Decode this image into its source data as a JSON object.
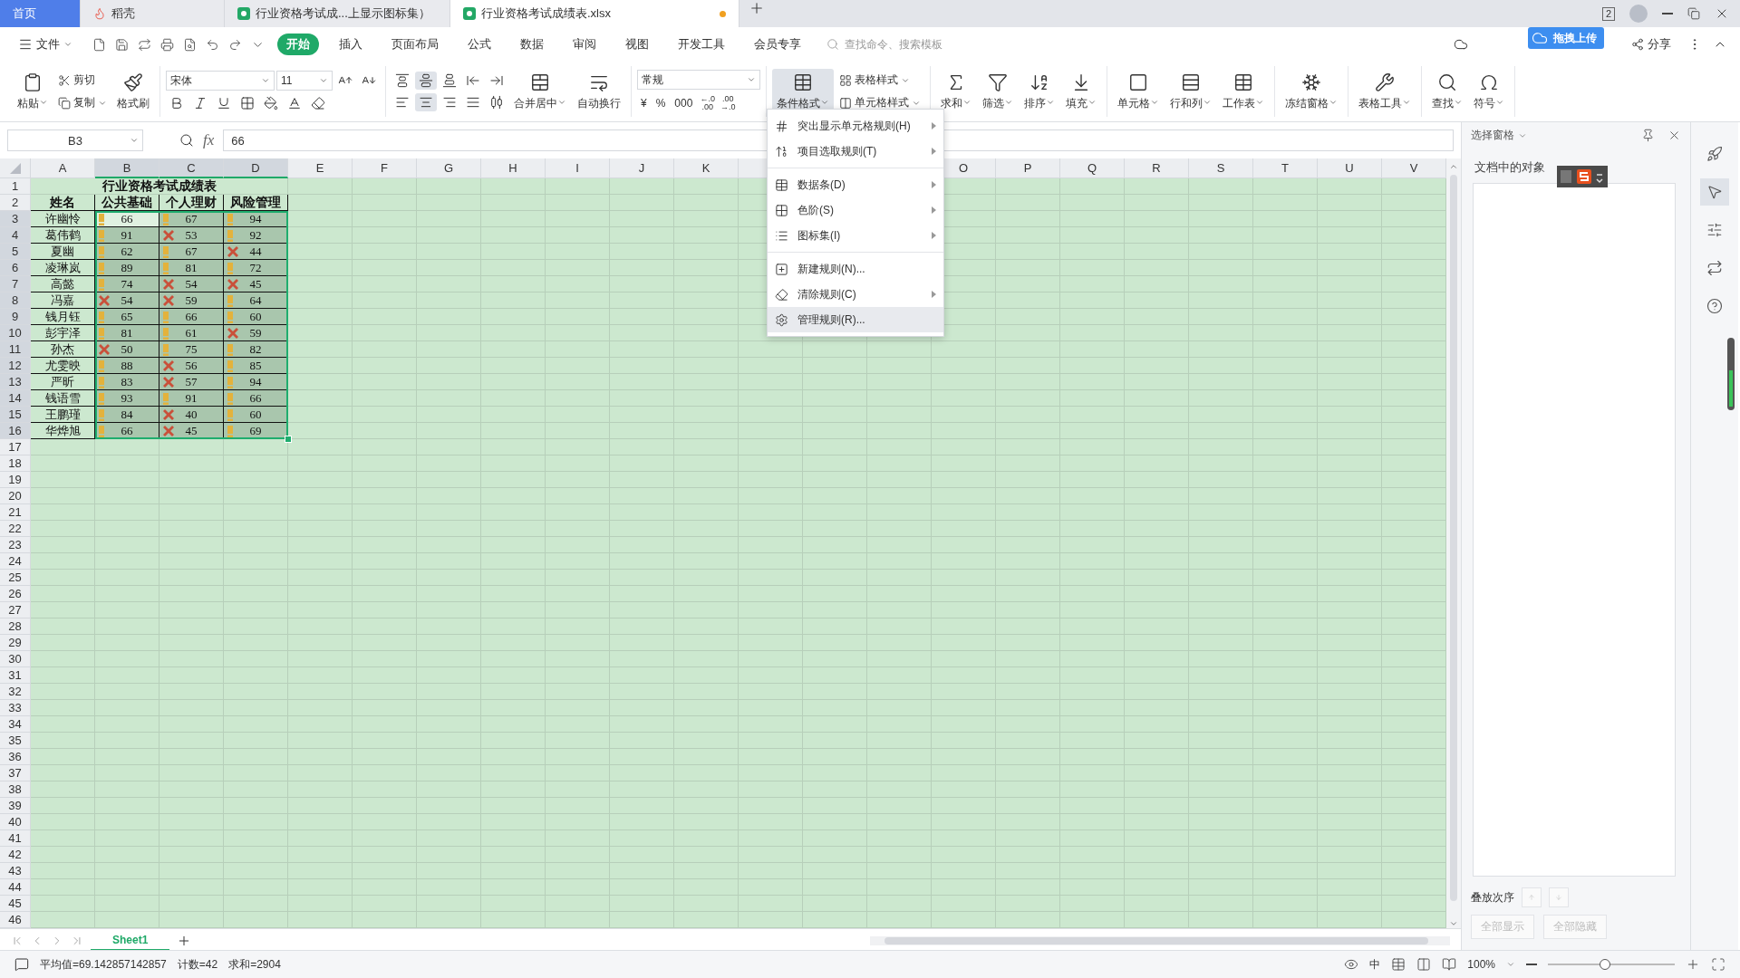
{
  "tabs": [
    {
      "kind": "home",
      "label": "首页",
      "selected": false,
      "unsaved": false
    },
    {
      "kind": "docer",
      "label": "稻壳",
      "selected": false,
      "unsaved": false
    },
    {
      "kind": "sheet",
      "label": "行业资格考试成...上显示图标集）",
      "selected": false,
      "unsaved": false
    },
    {
      "kind": "sheet",
      "label": "行业资格考试成绩表.xlsx",
      "selected": true,
      "unsaved": true
    }
  ],
  "window_count": "2",
  "menubar": {
    "file": "文件",
    "items": [
      {
        "label": "开始",
        "selected": true
      },
      {
        "label": "插入",
        "selected": false
      },
      {
        "label": "页面布局",
        "selected": false
      },
      {
        "label": "公式",
        "selected": false
      },
      {
        "label": "数据",
        "selected": false
      },
      {
        "label": "审阅",
        "selected": false
      },
      {
        "label": "视图",
        "selected": false
      },
      {
        "label": "开发工具",
        "selected": false
      },
      {
        "label": "会员专享",
        "selected": false
      }
    ],
    "search": {
      "placeholder": "查找命令、搜索模板"
    },
    "upload_badge": "拖拽上传",
    "share": "分享"
  },
  "ribbon": {
    "paste": "粘贴",
    "cut": "剪切",
    "copy": "复制",
    "format_painter": "格式刷",
    "font": "宋体",
    "font_size": "11",
    "alignment": {
      "vertical": [
        {
          "pressed": false
        },
        {
          "pressed": true
        },
        {
          "pressed": false
        }
      ],
      "horizontal": [
        {
          "pressed": false
        },
        {
          "pressed": true
        },
        {
          "pressed": false
        },
        {
          "pressed": false
        }
      ]
    },
    "merge": "合并居中",
    "wrap": "自动换行",
    "number_format": "常规",
    "number_buttons": [
      "¥",
      "%",
      "000"
    ],
    "decimal_buttons": [
      {
        "top": "←.0",
        "bottom": ".00"
      },
      {
        "top": ".00",
        "bottom": "→.0"
      }
    ],
    "conditional_format": {
      "label": "条件格式",
      "pressed": true
    },
    "table_style": "表格样式",
    "cell_style": "单元格样式",
    "tools": [
      "求和",
      "筛选",
      "排序",
      "填充",
      "单元格",
      "行和列",
      "工作表",
      "冻结窗格",
      "表格工具",
      "查找",
      "符号"
    ]
  },
  "formula_bar": {
    "name_box": "B3",
    "fx": "fx",
    "value": "66"
  },
  "sheet": {
    "columns": [
      {
        "label": "A",
        "selected": false
      },
      {
        "label": "B",
        "selected": true
      },
      {
        "label": "C",
        "selected": true
      },
      {
        "label": "D",
        "selected": true
      },
      {
        "label": "E",
        "selected": false
      },
      {
        "label": "F",
        "selected": false
      },
      {
        "label": "G",
        "selected": false
      },
      {
        "label": "H",
        "selected": false
      },
      {
        "label": "I",
        "selected": false
      },
      {
        "label": "J",
        "selected": false
      },
      {
        "label": "K",
        "selected": false
      },
      {
        "label": "O",
        "selected": false
      },
      {
        "label": "P",
        "selected": false
      },
      {
        "label": "Q",
        "selected": false
      },
      {
        "label": "R",
        "selected": false
      },
      {
        "label": "S",
        "selected": false
      },
      {
        "label": "T",
        "selected": false
      },
      {
        "label": "U",
        "selected": false
      },
      {
        "label": "V",
        "selected": false
      }
    ],
    "row_numbers": [
      {
        "label": "1",
        "selected": false
      },
      {
        "label": "2",
        "selected": false
      },
      {
        "label": "3",
        "selected": true
      },
      {
        "label": "4",
        "selected": true
      },
      {
        "label": "5",
        "selected": true
      },
      {
        "label": "6",
        "selected": true
      },
      {
        "label": "7",
        "selected": true
      },
      {
        "label": "8",
        "selected": true
      },
      {
        "label": "9",
        "selected": true
      },
      {
        "label": "10",
        "selected": true
      },
      {
        "label": "11",
        "selected": true
      },
      {
        "label": "12",
        "selected": true
      },
      {
        "label": "13",
        "selected": true
      },
      {
        "label": "14",
        "selected": true
      },
      {
        "label": "15",
        "selected": true
      },
      {
        "label": "16",
        "selected": true
      },
      {
        "label": "17",
        "selected": false
      },
      {
        "label": "18",
        "selected": false
      },
      {
        "label": "19",
        "selected": false
      },
      {
        "label": "20",
        "selected": false
      },
      {
        "label": "21",
        "selected": false
      },
      {
        "label": "22",
        "selected": false
      },
      {
        "label": "23",
        "selected": false
      },
      {
        "label": "24",
        "selected": false
      },
      {
        "label": "25",
        "selected": false
      },
      {
        "label": "26",
        "selected": false
      },
      {
        "label": "27",
        "selected": false
      },
      {
        "label": "28",
        "selected": false
      },
      {
        "label": "29",
        "selected": false
      },
      {
        "label": "30",
        "selected": false
      },
      {
        "label": "31",
        "selected": false
      },
      {
        "label": "32",
        "selected": false
      },
      {
        "label": "33",
        "selected": false
      },
      {
        "label": "34",
        "selected": false
      },
      {
        "label": "35",
        "selected": false
      },
      {
        "label": "36",
        "selected": false
      },
      {
        "label": "37",
        "selected": false
      },
      {
        "label": "38",
        "selected": false
      },
      {
        "label": "39",
        "selected": false
      },
      {
        "label": "40",
        "selected": false
      },
      {
        "label": "41",
        "selected": false
      },
      {
        "label": "42",
        "selected": false
      },
      {
        "label": "43",
        "selected": false
      },
      {
        "label": "44",
        "selected": false
      },
      {
        "label": "45",
        "selected": false
      },
      {
        "label": "46",
        "selected": false
      }
    ],
    "title": "行业资格考试成绩表",
    "headers": [
      "姓名",
      "公共基础",
      "个人理财",
      "风险管理"
    ],
    "rows": [
      {
        "name": "许幽怜",
        "scores": [
          {
            "value": "66",
            "kind": "warning",
            "active": true
          },
          {
            "value": "67",
            "kind": "warning",
            "active": false
          },
          {
            "value": "94",
            "kind": "warning",
            "active": false
          }
        ]
      },
      {
        "name": "葛伟鹤",
        "scores": [
          {
            "value": "91",
            "kind": "warning",
            "active": false
          },
          {
            "value": "53",
            "kind": "cross",
            "active": false
          },
          {
            "value": "92",
            "kind": "warning",
            "active": false
          }
        ]
      },
      {
        "name": "夏幽",
        "scores": [
          {
            "value": "62",
            "kind": "warning",
            "active": false
          },
          {
            "value": "67",
            "kind": "warning",
            "active": false
          },
          {
            "value": "44",
            "kind": "cross",
            "active": false
          }
        ]
      },
      {
        "name": "凌琳岚",
        "scores": [
          {
            "value": "89",
            "kind": "warning",
            "active": false
          },
          {
            "value": "81",
            "kind": "warning",
            "active": false
          },
          {
            "value": "72",
            "kind": "warning",
            "active": false
          }
        ]
      },
      {
        "name": "高懿",
        "scores": [
          {
            "value": "74",
            "kind": "warning",
            "active": false
          },
          {
            "value": "54",
            "kind": "cross",
            "active": false
          },
          {
            "value": "45",
            "kind": "cross",
            "active": false
          }
        ]
      },
      {
        "name": "冯嘉",
        "scores": [
          {
            "value": "54",
            "kind": "cross",
            "active": false
          },
          {
            "value": "59",
            "kind": "cross",
            "active": false
          },
          {
            "value": "64",
            "kind": "warning",
            "active": false
          }
        ]
      },
      {
        "name": "钱月钰",
        "scores": [
          {
            "value": "65",
            "kind": "warning",
            "active": false
          },
          {
            "value": "66",
            "kind": "warning",
            "active": false
          },
          {
            "value": "60",
            "kind": "warning",
            "active": false
          }
        ]
      },
      {
        "name": "彭宇泽",
        "scores": [
          {
            "value": "81",
            "kind": "warning",
            "active": false
          },
          {
            "value": "61",
            "kind": "warning",
            "active": false
          },
          {
            "value": "59",
            "kind": "cross",
            "active": false
          }
        ]
      },
      {
        "name": "孙杰",
        "scores": [
          {
            "value": "50",
            "kind": "cross",
            "active": false
          },
          {
            "value": "75",
            "kind": "warning",
            "active": false
          },
          {
            "value": "82",
            "kind": "warning",
            "active": false
          }
        ]
      },
      {
        "name": "尤雯映",
        "scores": [
          {
            "value": "88",
            "kind": "warning",
            "active": false
          },
          {
            "value": "56",
            "kind": "cross",
            "active": false
          },
          {
            "value": "85",
            "kind": "warning",
            "active": false
          }
        ]
      },
      {
        "name": "严昕",
        "scores": [
          {
            "value": "83",
            "kind": "warning",
            "active": false
          },
          {
            "value": "57",
            "kind": "cross",
            "active": false
          },
          {
            "value": "94",
            "kind": "warning",
            "active": false
          }
        ]
      },
      {
        "name": "钱语雪",
        "scores": [
          {
            "value": "93",
            "kind": "warning",
            "active": false
          },
          {
            "value": "91",
            "kind": "warning",
            "active": false
          },
          {
            "value": "66",
            "kind": "warning",
            "active": false
          }
        ]
      },
      {
        "name": "王鹏瑾",
        "scores": [
          {
            "value": "84",
            "kind": "warning",
            "active": false
          },
          {
            "value": "40",
            "kind": "cross",
            "active": false
          },
          {
            "value": "60",
            "kind": "warning",
            "active": false
          }
        ]
      },
      {
        "name": "华烨旭",
        "scores": [
          {
            "value": "66",
            "kind": "warning",
            "active": false
          },
          {
            "value": "45",
            "kind": "cross",
            "active": false
          },
          {
            "value": "69",
            "kind": "warning",
            "active": false
          }
        ]
      }
    ]
  },
  "conditional_menu": {
    "groups": [
      [
        {
          "label": "突出显示单元格规则(H)",
          "submenu": true,
          "selected": false
        },
        {
          "label": "项目选取规则(T)",
          "submenu": true,
          "selected": false
        }
      ],
      [
        {
          "label": "数据条(D)",
          "submenu": true,
          "selected": false
        },
        {
          "label": "色阶(S)",
          "submenu": true,
          "selected": false
        },
        {
          "label": "图标集(I)",
          "submenu": true,
          "selected": false
        }
      ],
      [
        {
          "label": "新建规则(N)...",
          "submenu": false,
          "selected": false
        },
        {
          "label": "清除规则(C)",
          "submenu": true,
          "selected": false
        },
        {
          "label": "管理规则(R)...",
          "submenu": false,
          "selected": true
        }
      ]
    ]
  },
  "selection_pane": {
    "title": "选择窗格",
    "subtitle": "文档中的对象",
    "order_label": "叠放次序",
    "order_disabled": true,
    "buttons": [
      {
        "label": "全部显示",
        "disabled": true
      },
      {
        "label": "全部隐藏",
        "disabled": true
      }
    ]
  },
  "sheet_tabs": [
    {
      "label": "Sheet1",
      "selected": true
    }
  ],
  "status_bar": {
    "stats": [
      "平均值=69.142857142857",
      "计数=42",
      "求和=2904"
    ],
    "ime": "中",
    "zoom": "100%",
    "zoom_slider": {
      "level": 0.45
    }
  }
}
